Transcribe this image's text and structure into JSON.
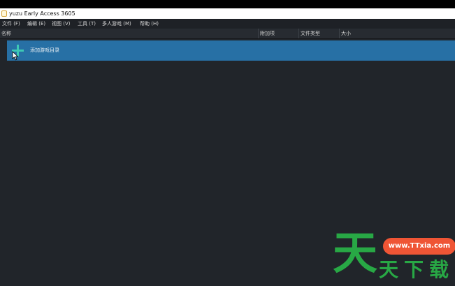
{
  "window": {
    "title": "yuzu Early Access 3605",
    "app_icon": "folder-icon"
  },
  "menu": [
    {
      "label": "文件 (F)"
    },
    {
      "label": "编辑 (E)"
    },
    {
      "label": "视图 (V)"
    },
    {
      "label": "工具 (T)"
    },
    {
      "label": "多人游戏 (M)"
    },
    {
      "label": "帮助 (H)"
    }
  ],
  "columns": [
    {
      "label": "名称"
    },
    {
      "label": "附加项"
    },
    {
      "label": "文件类型"
    },
    {
      "label": "大小"
    }
  ],
  "game_list": {
    "add_dir_label": "添加游戏目录",
    "add_icon": "plus-icon",
    "highlight_color": "#2770a5",
    "icon_color": "#3ec8b4"
  },
  "watermark": {
    "big_char": "天",
    "chars": [
      "天",
      "下",
      "载"
    ],
    "url": "www.TTxia.com",
    "text_color": "#28a845",
    "badge_color": "#ef5535"
  }
}
